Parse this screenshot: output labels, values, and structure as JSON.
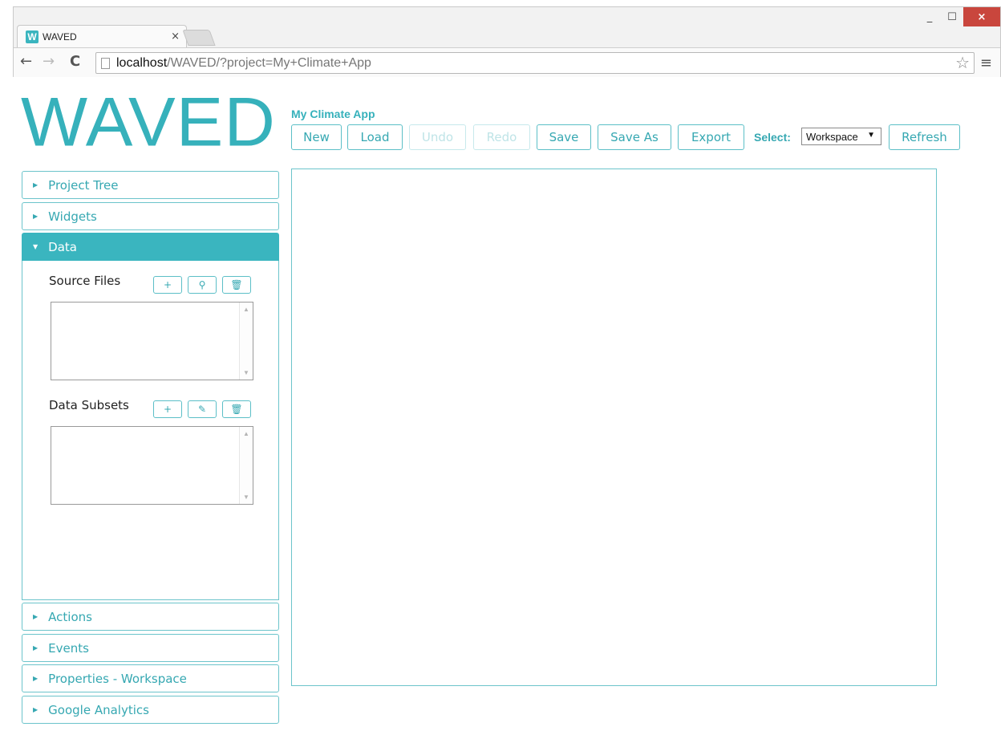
{
  "browser": {
    "tab_title": "WAVED",
    "favicon_letter": "W",
    "tab_close": "×",
    "url_host": "localhost",
    "url_rest": "/WAVED/?project=My+Climate+App",
    "window_minimize": "_",
    "window_maximize": "☐",
    "window_close": "×"
  },
  "app": {
    "logo": "WAVED",
    "project_title": "My Climate App"
  },
  "toolbar": {
    "buttons": [
      {
        "label": "New",
        "enabled": true
      },
      {
        "label": "Load",
        "enabled": true
      },
      {
        "label": "Undo",
        "enabled": false
      },
      {
        "label": "Redo",
        "enabled": false
      },
      {
        "label": "Save",
        "enabled": true
      },
      {
        "label": "Save As",
        "enabled": true
      },
      {
        "label": "Export",
        "enabled": true
      }
    ],
    "select_label": "Select:",
    "select_value": "Workspace",
    "refresh_label": "Refresh"
  },
  "sidebar": {
    "sections": [
      {
        "label": "Project Tree",
        "expanded": false
      },
      {
        "label": "Widgets",
        "expanded": false
      },
      {
        "label": "Data",
        "expanded": true
      },
      {
        "label": "Actions",
        "expanded": false
      },
      {
        "label": "Events",
        "expanded": false
      },
      {
        "label": "Properties - Workspace",
        "expanded": false
      },
      {
        "label": "Google Analytics",
        "expanded": false
      }
    ],
    "data_panel": {
      "source_files_label": "Source Files",
      "data_subsets_label": "Data Subsets",
      "source_files": [],
      "data_subsets": []
    }
  },
  "icons": {
    "collapsed": "triangle-right-icon",
    "expanded": "triangle-down-icon",
    "add": "plus-icon",
    "search": "search-icon",
    "delete": "trash-icon",
    "edit": "pencil-icon"
  },
  "colors": {
    "accent": "#3ab5bf",
    "accent_text": "#36a8b2",
    "border": "#6cc4cb",
    "disabled": "#bfe4e7"
  }
}
